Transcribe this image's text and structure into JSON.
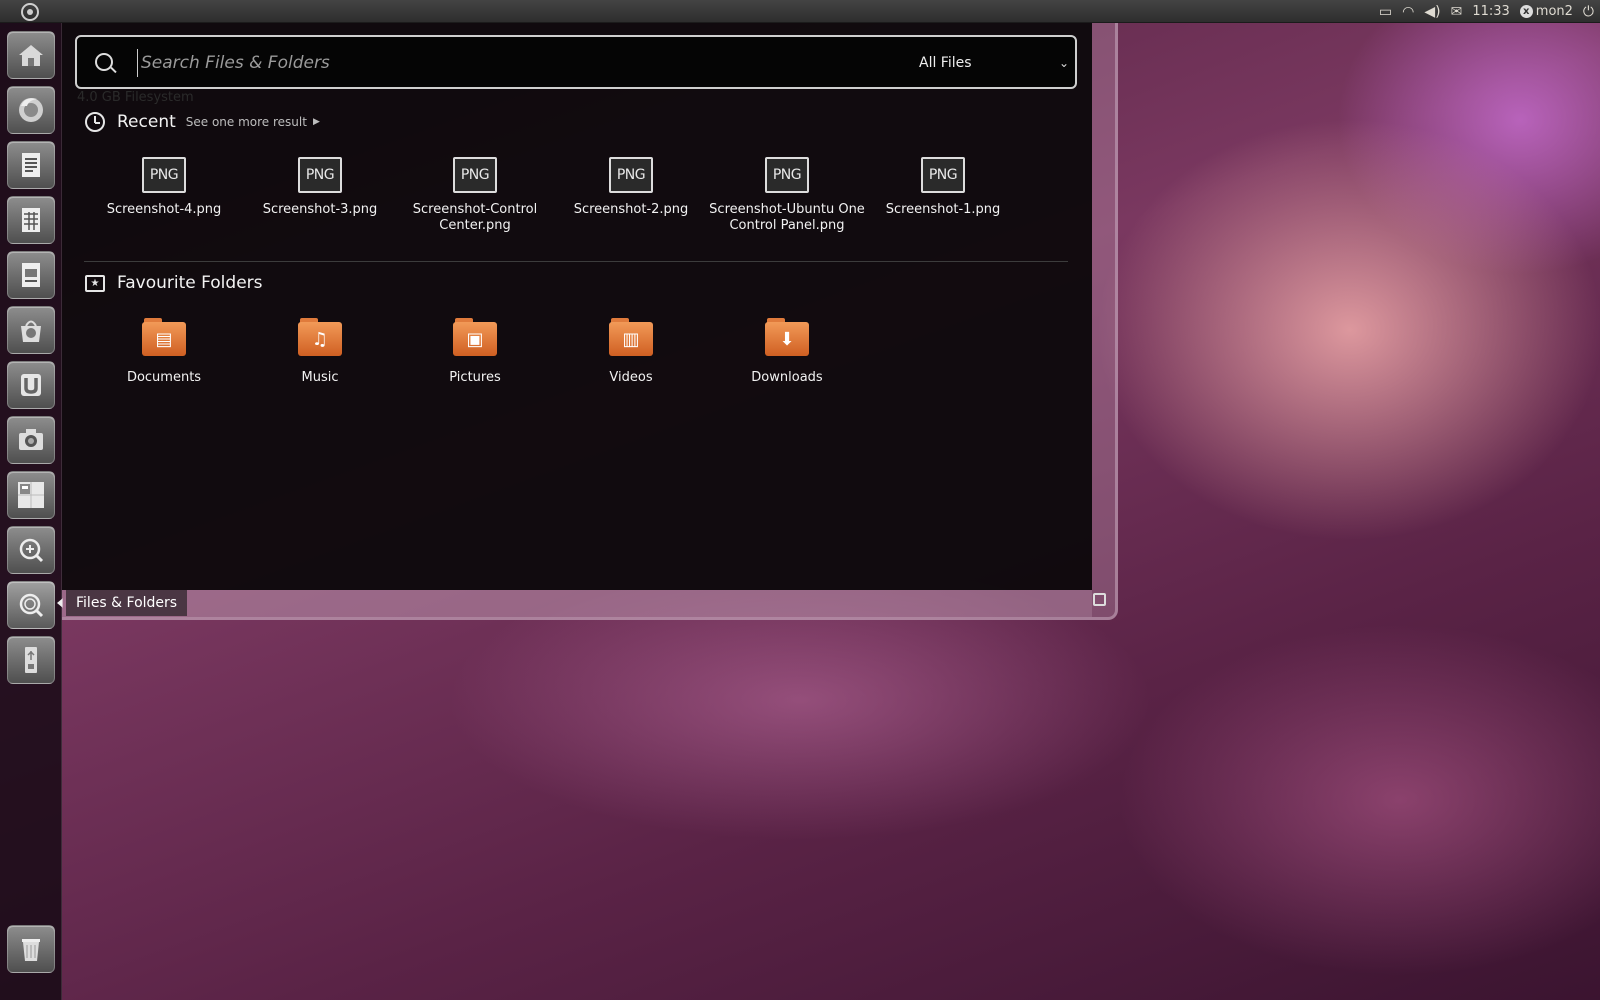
{
  "panel": {
    "time": "11:33",
    "user": "mon2",
    "icons": [
      "display-icon",
      "wifi-icon",
      "volume-icon",
      "mail-icon",
      "power-icon"
    ]
  },
  "launcher": {
    "items": [
      "home-folder",
      "firefox",
      "libreoffice-writer",
      "libreoffice-calc",
      "libreoffice-impress",
      "ubuntu-software-center",
      "ubuntu-one",
      "screenshot",
      "workspace-switcher",
      "applications-lens",
      "files-folders-lens",
      "usb-drive"
    ],
    "tooltip": "Files & Folders",
    "trash": "trash"
  },
  "search": {
    "placeholder": "Search Files & Folders",
    "filter": "All Files"
  },
  "ghost_text": "4.0 GB Filesystem",
  "recent": {
    "title": "Recent",
    "see_more": "See one more result",
    "items": [
      {
        "icon_text": "PNG",
        "label": "Screenshot-4.png"
      },
      {
        "icon_text": "PNG",
        "label": "Screenshot-3.png"
      },
      {
        "icon_text": "PNG",
        "label": "Screenshot-Control Center.png"
      },
      {
        "icon_text": "PNG",
        "label": "Screenshot-2.png"
      },
      {
        "icon_text": "PNG",
        "label": "Screenshot-Ubuntu One Control Panel.png"
      },
      {
        "icon_text": "PNG",
        "label": "Screenshot-1.png"
      }
    ]
  },
  "favourites": {
    "title": "Favourite Folders",
    "items": [
      {
        "label": "Documents",
        "glyph": "▤"
      },
      {
        "label": "Music",
        "glyph": "♫"
      },
      {
        "label": "Pictures",
        "glyph": "▣"
      },
      {
        "label": "Videos",
        "glyph": "▥"
      },
      {
        "label": "Downloads",
        "glyph": "⬇"
      }
    ]
  },
  "colors": {
    "folder_orange": "#e07b3c",
    "dash_background": "#0a0609",
    "panel": "#3c3c3c"
  }
}
